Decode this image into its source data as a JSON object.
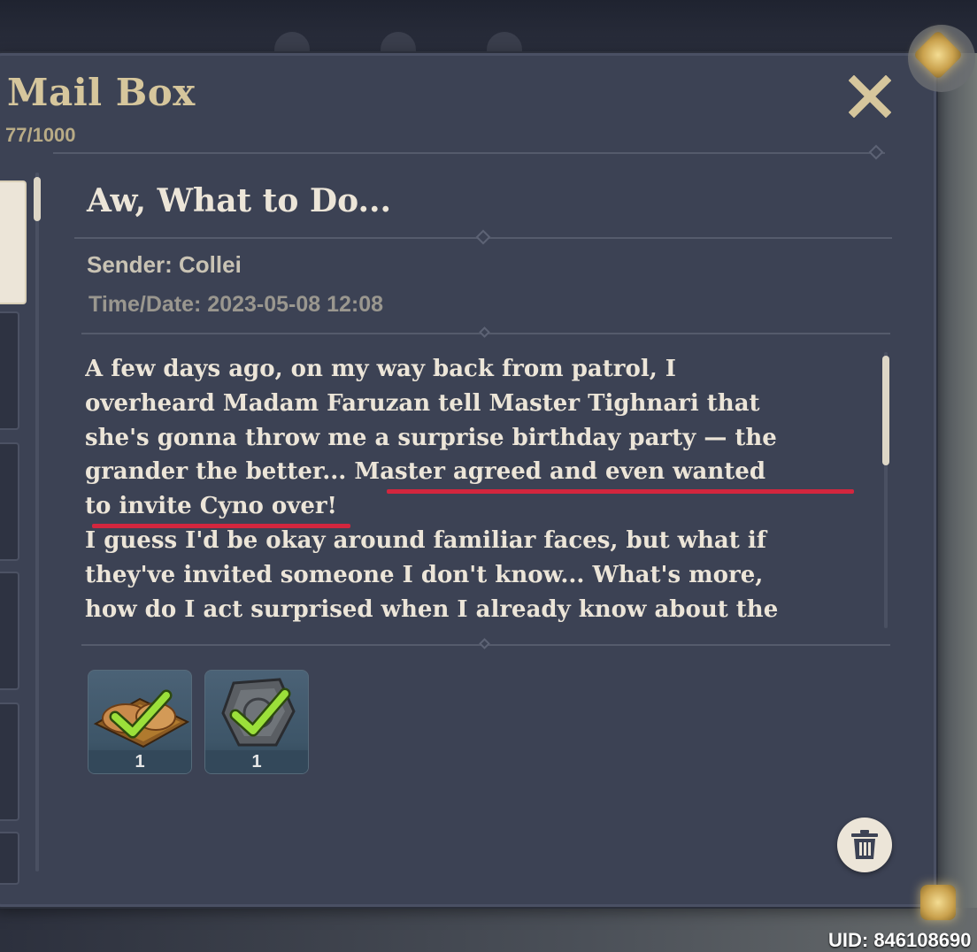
{
  "window": {
    "title": "Mail Box",
    "mail_count": "77/1000",
    "uid": "UID: 846108690"
  },
  "mail": {
    "subject": "Aw, What to Do...",
    "sender": "Sender: Collei",
    "time": "Time/Date: 2023-05-08 12:08",
    "body": "A few days ago, on my way back from patrol, I\noverheard Madam Faruzan tell Master Tighnari that\nshe's gonna throw me a surprise birthday party — the\ngrander the better... Master agreed and even wanted\nto invite Cyno over!\nI guess I'd be okay around familiar faces, but what if\nthey've invited someone I don't know... What's more,\nhow do I act surprised when I already know about the"
  },
  "attachments": [
    {
      "icon": "food-plate-icon",
      "quantity": "1",
      "claimed": true
    },
    {
      "icon": "stone-token-icon",
      "quantity": "1",
      "claimed": true
    }
  ],
  "colors": {
    "title_gold": "#d6c69c",
    "panel_bg": "#3c4254",
    "text_light": "#ece5d8",
    "underline_red": "#d3263e",
    "check_green": "#9be03a"
  },
  "icons": {
    "close": "close-icon",
    "delete": "trash-icon"
  }
}
